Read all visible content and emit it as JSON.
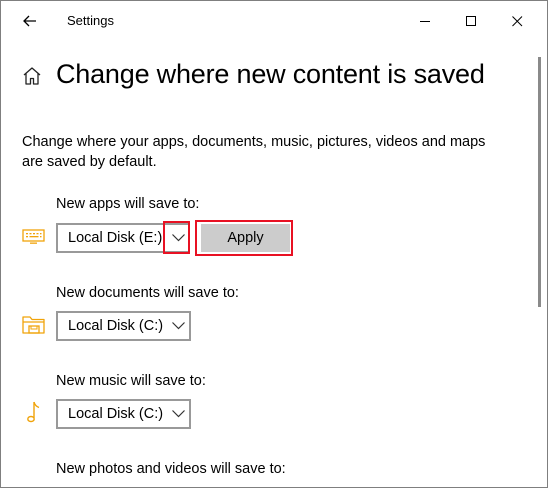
{
  "window": {
    "title": "Settings"
  },
  "header": {
    "title": "Change where new content is saved"
  },
  "description": "Change where your apps, documents, music, pictures, videos and maps are saved by default.",
  "sections": [
    {
      "label": "New apps will save to:",
      "selected": "Local Disk (E:)",
      "icon": "monitor-keyboard-icon"
    },
    {
      "label": "New documents will save to:",
      "selected": "Local Disk (C:)",
      "icon": "folder-icon"
    },
    {
      "label": "New music will save to:",
      "selected": "Local Disk (C:)",
      "icon": "music-note-icon"
    },
    {
      "label": "New photos and videos will save to:",
      "icon": "photo-icon"
    }
  ],
  "apply_label": "Apply",
  "colors": {
    "accent_icon": "#f0a30a",
    "highlight": "#e81123",
    "button_bg": "#cccccc",
    "dropdown_border": "#999999"
  }
}
